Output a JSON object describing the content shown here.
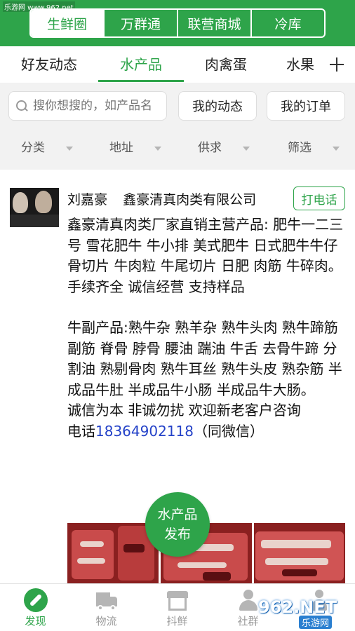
{
  "watermark_top": "乐游网 www.962.net",
  "top_tabs": [
    "生鲜圈",
    "万群通",
    "联营商城",
    "冷库"
  ],
  "category_tabs": [
    "好友动态",
    "水产品",
    "肉禽蛋",
    "水果"
  ],
  "search": {
    "placeholder": "搜你想搜的，如产品名"
  },
  "buttons": {
    "my_activity": "我的动态",
    "my_orders": "我的订单"
  },
  "filters": [
    "分类",
    "地址",
    "供求",
    "筛选"
  ],
  "post": {
    "author": "刘嘉豪",
    "company": "鑫豪清真肉类有限公司",
    "call_label": "打电话",
    "line1": "鑫豪清真肉类厂家直销主营产品: 肥牛一二三号 雪花肥牛 牛小排 美式肥牛 日式肥牛牛仔骨切片 牛肉粒 牛尾切片 日肥 肉筋  牛碎肉。手续齐全 诚信经营 支持样品",
    "line2": "牛副产品:熟牛杂 熟羊杂 熟牛头肉  熟牛蹄筋 副筋 脊骨 脖骨 腰油 踹油 牛舌 去骨牛蹄 分割油 熟剔骨肉 熟牛耳丝 熟牛头皮 熟杂筋 半成品牛肚 半成品牛小肠 半成品牛大肠。",
    "line3": "诚信为本 非诚勿扰 欢迎新老客户咨询",
    "phone_prefix": "电话",
    "phone": "18364902118",
    "phone_suffix": "（同微信）"
  },
  "fab": {
    "line1": "水产品",
    "line2": "发布"
  },
  "bottom_nav": [
    "发现",
    "物流",
    "抖鲜",
    "社群",
    ""
  ],
  "watermark_bottom": {
    "logo": "962.NET",
    "sub": "乐游网"
  },
  "colors": {
    "brand_green": "#2ea44a",
    "phone_link": "#2442c8"
  }
}
